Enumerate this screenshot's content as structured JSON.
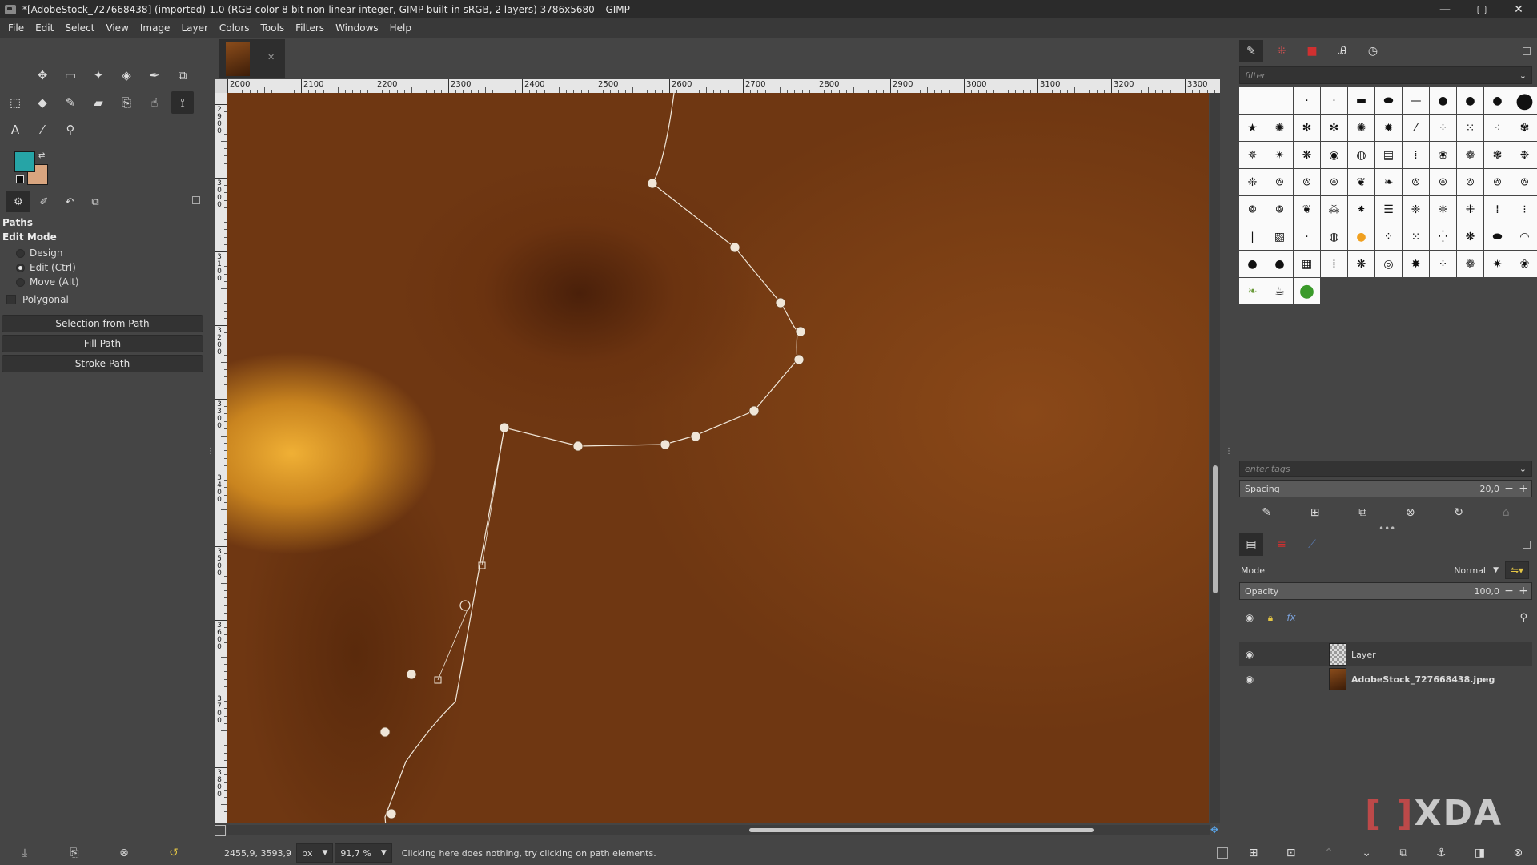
{
  "window": {
    "title": "*[AdobeStock_727668438] (imported)-1.0 (RGB color 8-bit non-linear integer, GIMP built-in sRGB, 2 layers) 3786x5680 – GIMP",
    "minimize": "—",
    "maximize": "▢",
    "close": "✕"
  },
  "menu": [
    "File",
    "Edit",
    "Select",
    "View",
    "Image",
    "Layer",
    "Colors",
    "Tools",
    "Filters",
    "Windows",
    "Help"
  ],
  "colors": {
    "foreground": "#26a4a6",
    "background": "#d9a57f"
  },
  "tool_options": {
    "title": "Paths",
    "edit_mode_label": "Edit Mode",
    "modes": [
      {
        "label": "Design",
        "checked": false
      },
      {
        "label": "Edit (Ctrl)",
        "checked": true
      },
      {
        "label": "Move (Alt)",
        "checked": false
      }
    ],
    "polygonal_label": "Polygonal",
    "buttons": [
      "Selection from Path",
      "Fill Path",
      "Stroke Path"
    ]
  },
  "ruler": {
    "h_labels": [
      "2000",
      "2100",
      "2200",
      "2300",
      "2400",
      "2500",
      "2600",
      "2700",
      "2800",
      "2900",
      "3000",
      "3100",
      "3200",
      "3300"
    ],
    "v_labels": [
      "2900",
      "3000",
      "3100",
      "3200",
      "3300",
      "3400",
      "3500",
      "3600",
      "3700",
      "3800"
    ]
  },
  "status": {
    "coords": "2455,9, 3593,9",
    "unit": "px",
    "zoom": "91,7 %",
    "message": "Clicking here does nothing, try clicking on path elements."
  },
  "brushes": {
    "filter_placeholder": "filter",
    "tags_placeholder": "enter tags",
    "spacing_label": "Spacing",
    "spacing_value": "20,0"
  },
  "layers": {
    "mode_label": "Mode",
    "mode_value": "Normal",
    "opacity_label": "Opacity",
    "opacity_value": "100,0",
    "items": [
      {
        "name": "Layer",
        "thumb": "checker",
        "bold": false
      },
      {
        "name": "AdobeStock_727668438.jpeg",
        "thumb": "photo",
        "bold": true
      }
    ]
  },
  "watermark": {
    "text": "XDA"
  }
}
